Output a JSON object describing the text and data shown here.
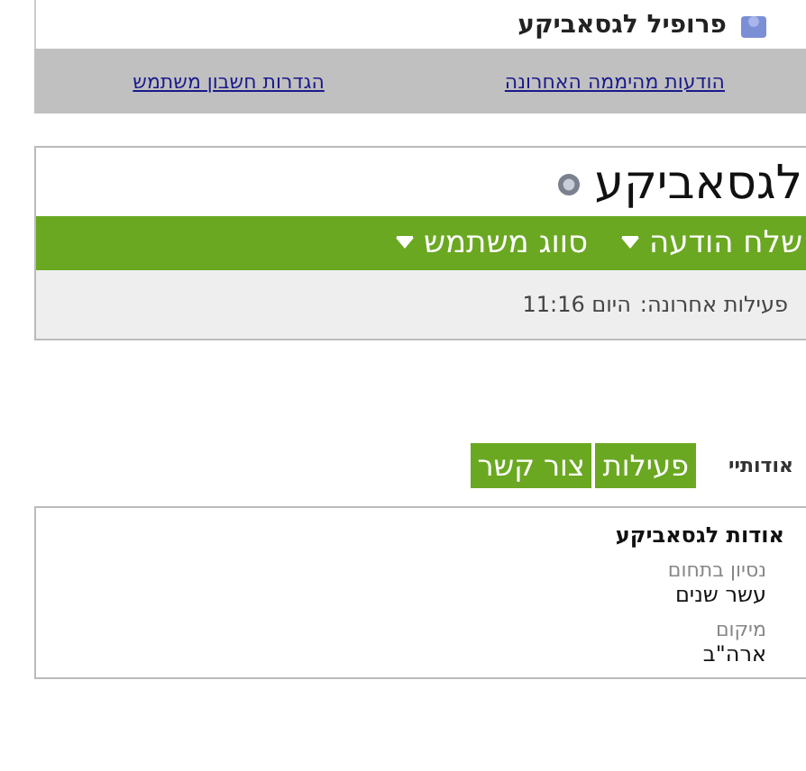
{
  "header": {
    "title": "פרופיל לגסאביקע"
  },
  "top_links": [
    "הודעות מהיממה האחרונה",
    "הגדרות חשבון משתמש"
  ],
  "profile": {
    "name": "לגסאביקע",
    "menus": [
      "שלח הודעה",
      "סווג משתמש"
    ],
    "last_activity_label": "פעילות אחרונה:",
    "last_activity_value": "היום 11:16"
  },
  "section_tabs": {
    "label": "אודותיי",
    "tabs": [
      "פעילות",
      "צור קשר"
    ]
  },
  "about": {
    "title": "אודות לגסאביקע",
    "fields": [
      {
        "label": "נסיון בתחום",
        "value": "עשר שנים"
      },
      {
        "label": "מיקום",
        "value": "ארה\"ב"
      }
    ]
  }
}
